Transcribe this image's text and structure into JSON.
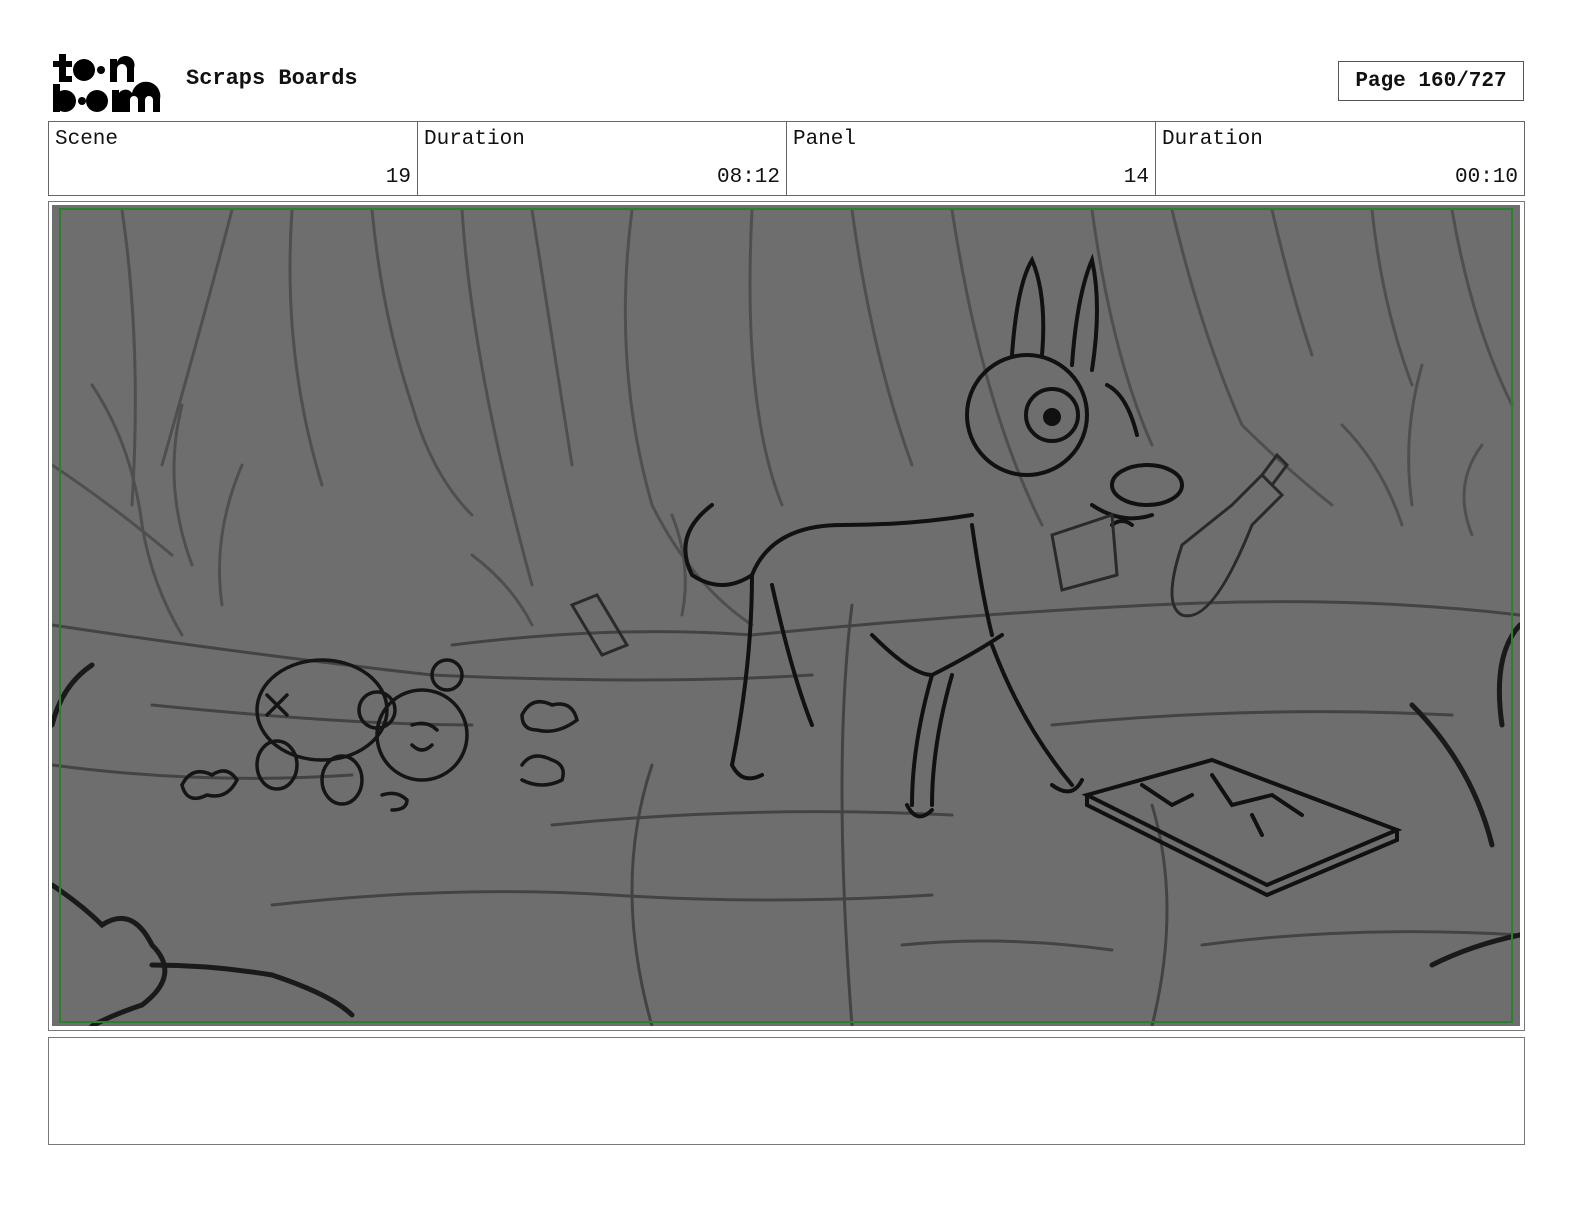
{
  "header": {
    "logo_text": "toon boom",
    "project_title": "Scraps Boards",
    "page_indicator": "Page 160/727"
  },
  "info": {
    "scene_label": "Scene",
    "scene_value": "19",
    "scene_duration_label": "Duration",
    "scene_duration_value": "08:12",
    "panel_label": "Panel",
    "panel_value": "14",
    "panel_duration_label": "Duration",
    "panel_duration_value": "00:10"
  },
  "panel": {
    "image_icon": "storyboard-sketch",
    "border_color": "#2f7d2f",
    "background_color": "#6e6e6e"
  },
  "notes": {
    "text": ""
  }
}
